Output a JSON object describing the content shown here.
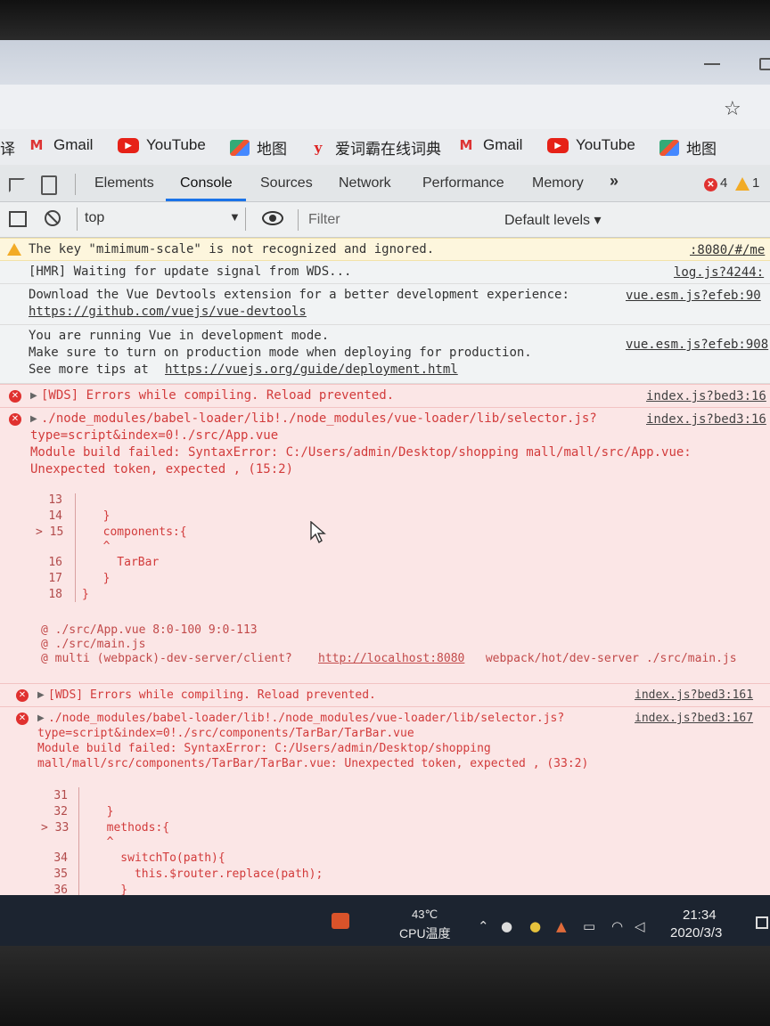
{
  "bookmarks": [
    {
      "label": "Gmail",
      "icon": "gmail-icon"
    },
    {
      "label": "YouTube",
      "icon": "youtube-icon"
    },
    {
      "label": "地图",
      "icon": "maps-icon"
    },
    {
      "label": "爱词霸在线词典",
      "icon": "iciba-icon"
    },
    {
      "label": "Gmail",
      "icon": "gmail-icon"
    },
    {
      "label": "YouTube",
      "icon": "youtube-icon"
    },
    {
      "label": "地图",
      "icon": "maps-icon"
    }
  ],
  "devtools": {
    "tabs": [
      "Elements",
      "Console",
      "Sources",
      "Network",
      "Performance",
      "Memory"
    ],
    "active_tab": "Console",
    "more_tabs": "»",
    "error_count": "4",
    "warning_count": "1",
    "context": "top",
    "filter_placeholder": "Filter",
    "levels": "Default levels ▾"
  },
  "console": {
    "warn1": {
      "text": "The key \"mimimum-scale\" is not recognized and ignored.",
      "source": ":8080/#/me"
    },
    "hmr": {
      "text": "[HMR] Waiting for update signal from WDS...",
      "source": "log.js?4244:"
    },
    "devtools_tip": {
      "line1": "Download the Vue Devtools extension for a better development experience:",
      "link": "https://github.com/vuejs/vue-devtools",
      "source": "vue.esm.js?efeb:90"
    },
    "dev_mode": {
      "line1": "You are running Vue in development mode.",
      "line2": "Make sure to turn on production mode when deploying for production.",
      "line3_prefix": "See more tips at ",
      "link": "https://vuejs.org/guide/deployment.html",
      "source": "vue.esm.js?efeb:908"
    },
    "err1": {
      "text": "[WDS] Errors while compiling. Reload prevented.",
      "source": "index.js?bed3:16"
    },
    "err2": {
      "line1": "./node_modules/babel-loader/lib!./node_modules/vue-loader/lib/selector.js?",
      "line2": "type=script&index=0!./src/App.vue",
      "line3": "Module build failed: SyntaxError: C:/Users/admin/Desktop/shopping mall/mall/src/App.vue:",
      "line4": "Unexpected token, expected , (15:2)",
      "source": "index.js?bed3:16",
      "code": [
        {
          "ln": "13",
          "text": ""
        },
        {
          "ln": "14",
          "text": "  }"
        },
        {
          "ln": "> 15",
          "text": "  components:{"
        },
        {
          "ln": "",
          "text": "  ^"
        },
        {
          "ln": "16",
          "text": "    TarBar"
        },
        {
          "ln": "17",
          "text": "  }"
        },
        {
          "ln": "18",
          "text": "}"
        }
      ],
      "stack1": "@ ./src/App.vue 8:0-100 9:0-113",
      "stack2": "@ ./src/main.js",
      "stack3_prefix": "@ multi (webpack)-dev-server/client?",
      "stack3_link": "http://localhost:8080",
      "stack3_suffix": " webpack/hot/dev-server ./src/main.js"
    },
    "err3": {
      "text": "[WDS] Errors while compiling. Reload prevented.",
      "source": "index.js?bed3:161"
    },
    "err4": {
      "line1": "./node_modules/babel-loader/lib!./node_modules/vue-loader/lib/selector.js?",
      "line2": "type=script&index=0!./src/components/TarBar/TarBar.vue",
      "line3": "Module build failed: SyntaxError: C:/Users/admin/Desktop/shopping",
      "line4": "mall/mall/src/components/TarBar/TarBar.vue: Unexpected token, expected , (33:2)",
      "source": "index.js?bed3:167",
      "code": [
        {
          "ln": "31",
          "text": ""
        },
        {
          "ln": "32",
          "text": "  }"
        },
        {
          "ln": "> 33",
          "text": "  methods:{"
        },
        {
          "ln": "",
          "text": "  ^"
        },
        {
          "ln": "34",
          "text": "    switchTo(path){"
        },
        {
          "ln": "35",
          "text": "      this.$router.replace(path);"
        },
        {
          "ln": "36",
          "text": "    }"
        }
      ]
    }
  },
  "taskbar": {
    "temp": "43℃",
    "temp_label": "CPU温度",
    "time": "21:34",
    "date": "2020/3/3"
  }
}
